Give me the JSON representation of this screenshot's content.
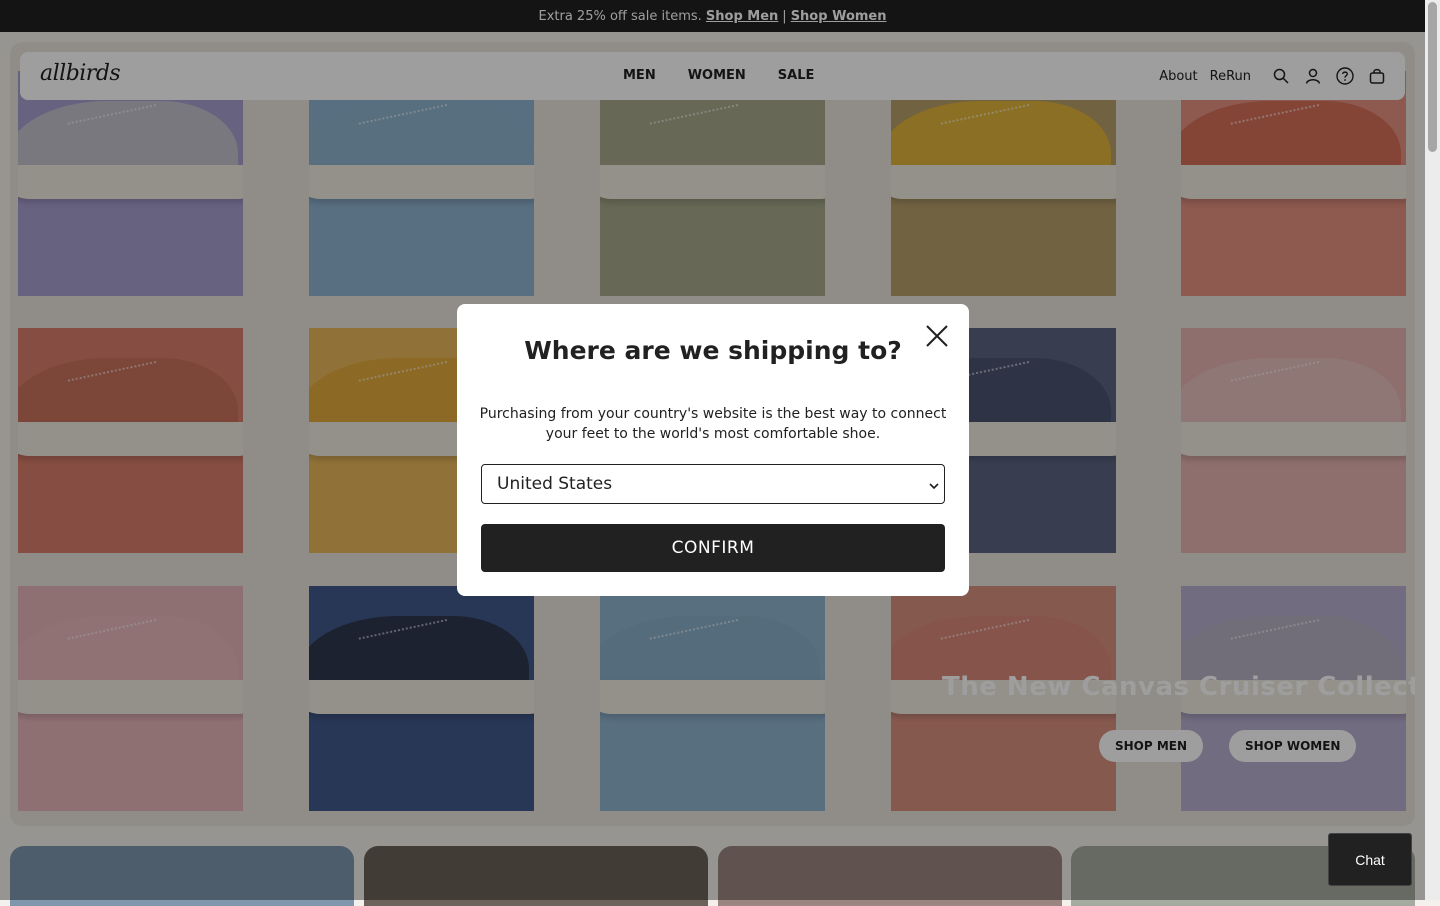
{
  "promo": {
    "text": "Extra 25% off sale items.",
    "men_link": "Shop Men",
    "separator": "|",
    "women_link": "Shop Women"
  },
  "nav": {
    "logo": "allbirds",
    "items": [
      "MEN",
      "WOMEN",
      "SALE"
    ],
    "about": "About",
    "rerun": "ReRun",
    "icons": [
      "search-icon",
      "account-icon",
      "help-icon",
      "cart-icon"
    ]
  },
  "hero": {
    "title": "The New Canvas Cruiser Collection",
    "shop_men": "SHOP MEN",
    "shop_women": "SHOP WOMEN",
    "tiles": [
      {
        "bg": "#a89fd1",
        "shoe": "#c4c2cc"
      },
      {
        "bg": "#8fb2d1",
        "shoe": "#8fb3cf"
      },
      {
        "bg": "#a6a88a",
        "shoe": "#a8a98b"
      },
      {
        "bg": "#b79e6a",
        "shoe": "#e0b43a"
      },
      {
        "bg": "#e59080",
        "shoe": "#d6705a"
      },
      {
        "bg": "#d97d6b",
        "shoe": "#c8715d"
      },
      {
        "bg": "#e9b85c",
        "shoe": "#e2ab3d"
      },
      {
        "bg": "#7a7a7a",
        "shoe": "#7a7a7a"
      },
      {
        "bg": "#5b6582",
        "shoe": "#4b5470"
      },
      {
        "bg": "#e5b3b0",
        "shoe": "#e6c0bd"
      },
      {
        "bg": "#e7b5b9",
        "shoe": "#e8b9bd"
      },
      {
        "bg": "#40598a",
        "shoe": "#2f3850"
      },
      {
        "bg": "#8fb3cf",
        "shoe": "#8aaec8"
      },
      {
        "bg": "#d99080",
        "shoe": "#d9887a"
      },
      {
        "bg": "#b8aed0",
        "shoe": "#b7b2c4"
      }
    ]
  },
  "cards": [
    "#7f97ad",
    "#6b625a",
    "#9b8580",
    "#a5aba0"
  ],
  "modal": {
    "title": "Where are we shipping to?",
    "description": "Purchasing from your country's website is the best way to connect your feet to the world's most comfortable shoe.",
    "country": "United States",
    "confirm": "CONFIRM"
  },
  "chat": "Chat"
}
